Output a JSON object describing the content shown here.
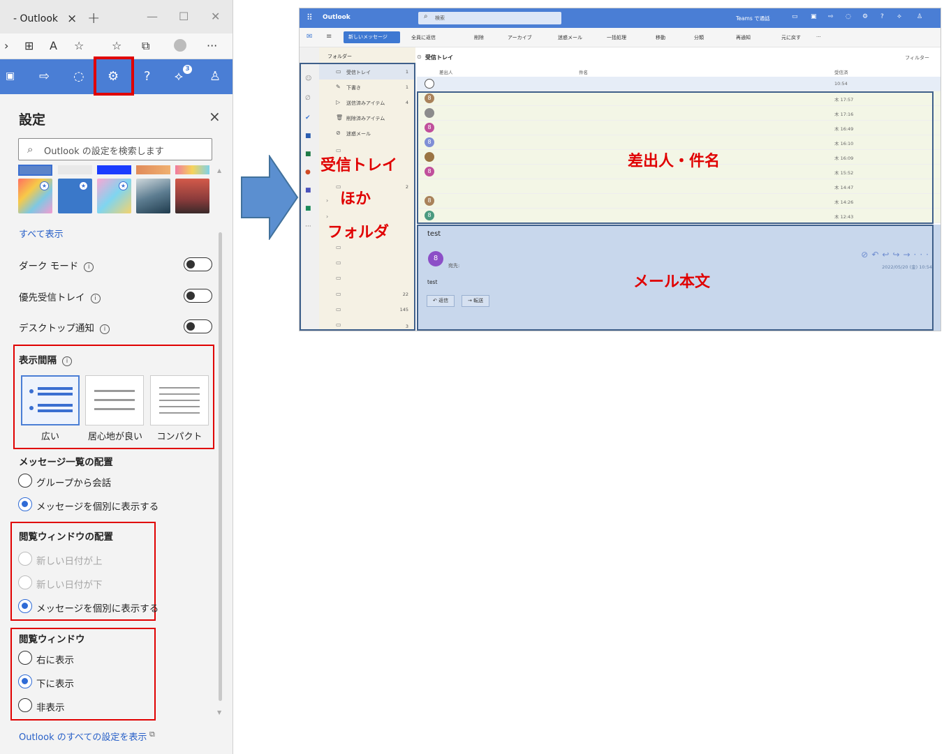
{
  "browser": {
    "tab_title": "- Outlook",
    "tab_close": "×",
    "new_tab": "+",
    "more": "···"
  },
  "settings": {
    "title": "設定",
    "close": "×",
    "search_placeholder": "Outlook の設定を検索します",
    "show_all": "すべて表示",
    "dark_mode": "ダーク モード",
    "focused_inbox": "優先受信トレイ",
    "desktop_notifications": "デスクトップ通知",
    "density": {
      "title": "表示間隔",
      "options": [
        "広い",
        "居心地が良い",
        "コンパクト"
      ],
      "selected": "広い"
    },
    "message_list": {
      "title": "メッセージ一覧の配置",
      "options": [
        "グループから会話",
        "メッセージを個別に表示する"
      ],
      "selected": "メッセージを個別に表示する"
    },
    "reading_order": {
      "title": "閲覧ウィンドウの配置",
      "options": [
        "新しい日付が上",
        "新しい日付が下",
        "メッセージを個別に表示する"
      ],
      "selected": "メッセージを個別に表示する"
    },
    "reading_pane": {
      "title": "閲覧ウィンドウ",
      "options": [
        "右に表示",
        "下に表示",
        "非表示"
      ],
      "selected": "下に表示"
    },
    "all_settings_link": "Outlook のすべての設定を表示",
    "notification_count": "3"
  },
  "outlook": {
    "app_name": "Outlook",
    "search_placeholder": "検索",
    "teams_call": "Teams で通話",
    "new_message": "新しいメッセージ",
    "commands": [
      "全員に返信",
      "削除",
      "アーカイブ",
      "迷惑メール",
      "一括処理",
      "移動",
      "分類",
      "再通知",
      "元に戻す",
      "···"
    ],
    "folders_header": "フォルダー",
    "folders": [
      {
        "name": "受信トレイ",
        "count": "1"
      },
      {
        "name": "下書き",
        "count": "1"
      },
      {
        "name": "送信済みアイテム",
        "count": "4"
      },
      {
        "name": "削除済みアイテム",
        "count": ""
      },
      {
        "name": "迷惑メール",
        "count": ""
      }
    ],
    "extra_folder_counts": [
      "2",
      "22",
      "145",
      "3"
    ],
    "list_title": "受信トレイ",
    "filter": "フィルター",
    "col_sender": "差出人",
    "col_subject": "件名",
    "col_received": "受信済",
    "rows": [
      {
        "time": "10:54",
        "avatar": "",
        "color": "#ffffff"
      },
      {
        "time": "木 17:57",
        "avatar": "8",
        "color": "#a9825a"
      },
      {
        "time": "木 17:16",
        "avatar": "",
        "color": "#8c8c8c"
      },
      {
        "time": "木 16:49",
        "avatar": "8",
        "color": "#c04f9c"
      },
      {
        "time": "木 16:10",
        "avatar": "8",
        "color": "#7f8ed6"
      },
      {
        "time": "木 16:09",
        "avatar": "",
        "color": "#9a7443"
      },
      {
        "time": "木 15:52",
        "avatar": "8",
        "color": "#c04f9c"
      },
      {
        "time": "木 14:47",
        "avatar": "",
        "color": "#f3f6e6"
      },
      {
        "time": "木 14:26",
        "avatar": "8",
        "color": "#a9825a"
      },
      {
        "time": "木 12:43",
        "avatar": "8",
        "color": "#4a9a80"
      }
    ],
    "reading": {
      "subject": "test",
      "to_label": "宛先:",
      "date": "2022/05/20 (金) 10:54",
      "body": "test",
      "reply": "返信",
      "forward": "転送"
    }
  },
  "annotations": {
    "folders_label": [
      "受信トレイ",
      "ほか",
      "フォルダ"
    ],
    "list_label": "差出人・件名",
    "body_label": "メール本文"
  },
  "colors": {
    "owa_blue": "#4a7ed5",
    "highlight_red": "#e00000",
    "arrow_blue": "#5b8fd0"
  }
}
